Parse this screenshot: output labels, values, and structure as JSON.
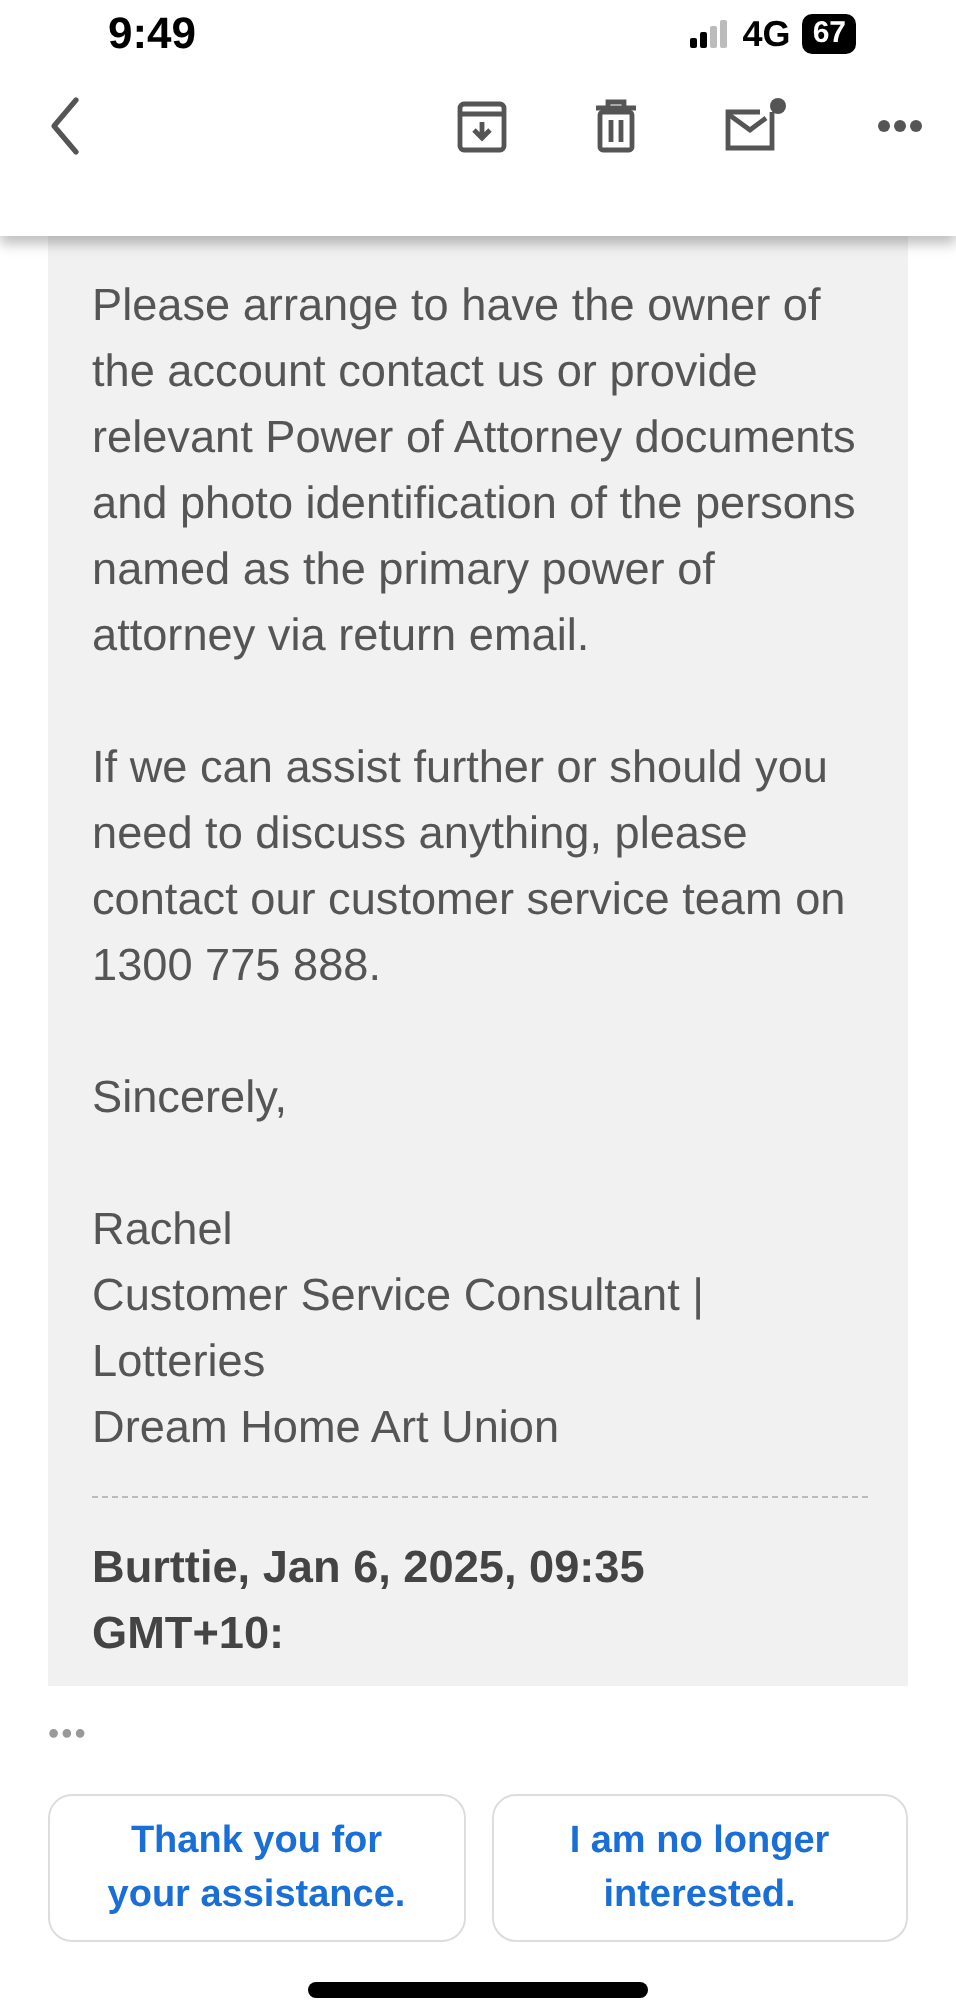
{
  "status_bar": {
    "time": "9:49",
    "network": "4G",
    "battery": "67"
  },
  "message": {
    "paragraphs": [
      "Please arrange to have the owner of the account contact us or provide relevant Power of Attorney documents and photo identification of the persons named as the primary power of attorney via return email.",
      "If we can assist further or should you need to discuss anything, please contact our customer service team on 1300 775 888.",
      "Sincerely,"
    ],
    "signature": [
      "Rachel",
      "Customer Service Consultant | Lotteries",
      "Dream Home Art Union"
    ],
    "quote_header": "Burttie, Jan 6, 2025, 09:35 GMT+10:"
  },
  "more": "•••",
  "smart_replies": [
    "Thank you for your assistance.",
    "I am no longer interested."
  ]
}
